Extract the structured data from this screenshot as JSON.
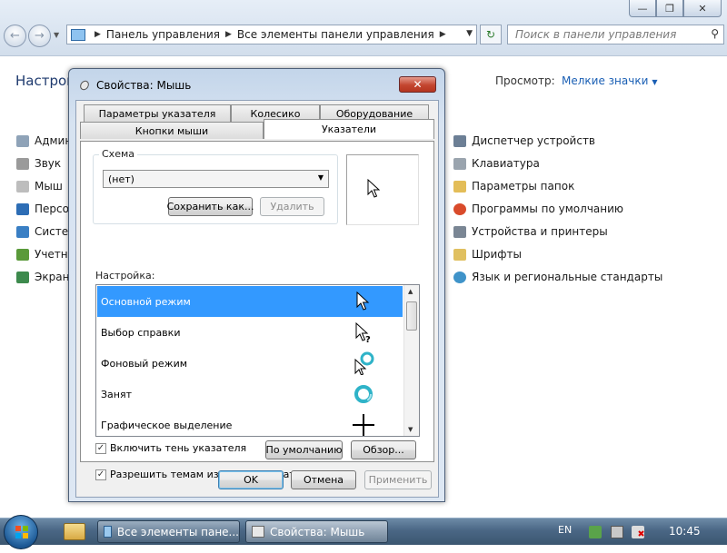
{
  "explorer": {
    "breadcrumb": [
      "Панель управления",
      "Все элементы панели управления"
    ],
    "search_placeholder": "Поиск в панели управления",
    "page_title": "Настрой",
    "view_label": "Просмотр:",
    "view_value": "Мелкие значки",
    "left_items": [
      "Админ",
      "Звук",
      "Мыш",
      "Персо",
      "Систем",
      "Учетны",
      "Экран"
    ],
    "right_items": [
      "Диспетчер устройств",
      "Клавиатура",
      "Параметры папок",
      "Программы по умолчанию",
      "Устройства и принтеры",
      "Шрифты",
      "Язык и региональные стандарты"
    ]
  },
  "dialog": {
    "title": "Свойства: Мышь",
    "tabs_back": [
      "Параметры указателя",
      "Колесико",
      "Оборудование"
    ],
    "tabs_front": [
      "Кнопки мыши",
      "Указатели"
    ],
    "active_tab": "Указатели",
    "scheme_label": "Схема",
    "scheme_value": "(нет)",
    "save_as": "Сохранить как...",
    "delete": "Удалить",
    "customize_label": "Настройка:",
    "pointers": [
      {
        "label": "Основной режим",
        "icon": "arrow-cursor-icon",
        "selected": true
      },
      {
        "label": "Выбор справки",
        "icon": "help-cursor-icon",
        "selected": false
      },
      {
        "label": "Фоновый режим",
        "icon": "working-in-background-cursor-icon",
        "selected": false
      },
      {
        "label": "Занят",
        "icon": "busy-cursor-icon",
        "selected": false
      },
      {
        "label": "Графическое выделение",
        "icon": "crosshair-cursor-icon",
        "selected": false
      }
    ],
    "shadow_label": "Включить тень указателя",
    "shadow_checked": true,
    "themes_label": "Разрешить темам изменять указатели мыши",
    "themes_checked": true,
    "default_btn": "По умолчанию",
    "browse_btn": "Обзор...",
    "ok": "OK",
    "cancel": "Отмена",
    "apply": "Применить"
  },
  "taskbar": {
    "tasks": [
      "Все элементы пане...",
      "Свойства: Мышь"
    ],
    "lang": "EN",
    "time": "10:45"
  },
  "colors": {
    "selection": "#3399ff",
    "link": "#1a5fb4",
    "close_red": "#c3452f"
  }
}
